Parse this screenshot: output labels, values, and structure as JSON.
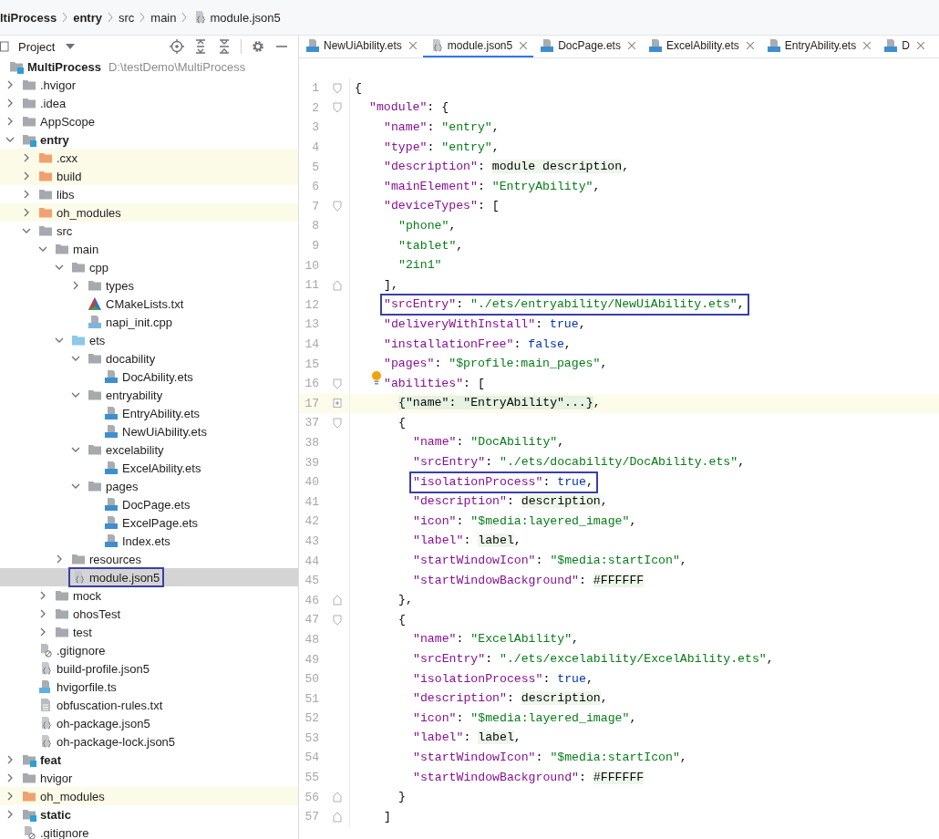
{
  "breadcrumb": [
    {
      "label": "ltiProcess",
      "kind": "module"
    },
    {
      "label": "entry",
      "kind": "module"
    },
    {
      "label": "src",
      "kind": "folder"
    },
    {
      "label": "main",
      "kind": "folder"
    },
    {
      "label": "module.json5",
      "kind": "json"
    }
  ],
  "project_panel": {
    "title": "Project",
    "root": {
      "label": "MultiProcess",
      "path": "D:\\testDemo\\MultiProcess"
    },
    "tree": [
      {
        "label": ".hvigor",
        "kind": "folder",
        "expanded": false,
        "selected": false
      },
      {
        "label": ".idea",
        "kind": "folder",
        "expanded": false,
        "selected": false
      },
      {
        "label": "AppScope",
        "kind": "folder",
        "expanded": false,
        "selected": false
      },
      {
        "label": "entry",
        "kind": "module",
        "expanded": true,
        "selected": false,
        "children": [
          {
            "label": ".cxx",
            "kind": "excluded",
            "expanded": false,
            "selected": false
          },
          {
            "label": "build",
            "kind": "excluded",
            "expanded": false,
            "selected": false
          },
          {
            "label": "libs",
            "kind": "folder",
            "expanded": false,
            "selected": false
          },
          {
            "label": "oh_modules",
            "kind": "excluded",
            "expanded": false,
            "selected": false
          },
          {
            "label": "src",
            "kind": "folder",
            "expanded": true,
            "selected": false,
            "children": [
              {
                "label": "main",
                "kind": "folder",
                "expanded": true,
                "selected": false,
                "children": [
                  {
                    "label": "cpp",
                    "kind": "folder",
                    "expanded": true,
                    "selected": false,
                    "children": [
                      {
                        "label": "types",
                        "kind": "folder",
                        "expanded": false,
                        "selected": false
                      },
                      {
                        "label": "CMakeLists.txt",
                        "kind": "cmake",
                        "selected": false
                      },
                      {
                        "label": "napi_init.cpp",
                        "kind": "cpp",
                        "selected": false
                      }
                    ]
                  },
                  {
                    "label": "ets",
                    "kind": "source",
                    "expanded": true,
                    "selected": false,
                    "children": [
                      {
                        "label": "docability",
                        "kind": "folder",
                        "expanded": true,
                        "selected": false,
                        "children": [
                          {
                            "label": "DocAbility.ets",
                            "kind": "ets",
                            "selected": false
                          }
                        ]
                      },
                      {
                        "label": "entryability",
                        "kind": "folder",
                        "expanded": true,
                        "selected": false,
                        "children": [
                          {
                            "label": "EntryAbility.ets",
                            "kind": "ets",
                            "selected": false
                          },
                          {
                            "label": "NewUiAbility.ets",
                            "kind": "ets",
                            "selected": false
                          }
                        ]
                      },
                      {
                        "label": "excelability",
                        "kind": "folder",
                        "expanded": true,
                        "selected": false,
                        "children": [
                          {
                            "label": "ExcelAbility.ets",
                            "kind": "ets",
                            "selected": false
                          }
                        ]
                      },
                      {
                        "label": "pages",
                        "kind": "folder",
                        "expanded": true,
                        "selected": false,
                        "children": [
                          {
                            "label": "DocPage.ets",
                            "kind": "ets",
                            "selected": false
                          },
                          {
                            "label": "ExcelPage.ets",
                            "kind": "ets",
                            "selected": false
                          },
                          {
                            "label": "Index.ets",
                            "kind": "ets",
                            "selected": false
                          }
                        ]
                      }
                    ]
                  },
                  {
                    "label": "resources",
                    "kind": "folder",
                    "expanded": false,
                    "selected": false
                  },
                  {
                    "label": "module.json5",
                    "kind": "json",
                    "selected": true,
                    "boxed": true
                  }
                ]
              },
              {
                "label": "mock",
                "kind": "folder",
                "expanded": false,
                "selected": false
              },
              {
                "label": "ohosTest",
                "kind": "folder",
                "expanded": false,
                "selected": false
              },
              {
                "label": "test",
                "kind": "folder",
                "expanded": false,
                "selected": false
              }
            ]
          },
          {
            "label": ".gitignore",
            "kind": "ignore",
            "selected": false
          },
          {
            "label": "build-profile.json5",
            "kind": "json",
            "selected": false
          },
          {
            "label": "hvigorfile.ts",
            "kind": "ts",
            "selected": false
          },
          {
            "label": "obfuscation-rules.txt",
            "kind": "txt",
            "selected": false
          },
          {
            "label": "oh-package.json5",
            "kind": "json",
            "selected": false
          },
          {
            "label": "oh-package-lock.json5",
            "kind": "json",
            "selected": false
          }
        ]
      },
      {
        "label": "feat",
        "kind": "module",
        "expanded": false,
        "selected": false
      },
      {
        "label": "hvigor",
        "kind": "folder",
        "expanded": false,
        "selected": false
      },
      {
        "label": "oh_modules",
        "kind": "excluded",
        "expanded": false,
        "selected": false
      },
      {
        "label": "static",
        "kind": "module",
        "expanded": false,
        "selected": false
      },
      {
        "label": ".gitignore",
        "kind": "ignore",
        "selected": false
      }
    ]
  },
  "tabs": [
    {
      "label": "NewUiAbility.ets",
      "kind": "ets",
      "selected": false
    },
    {
      "label": "module.json5",
      "kind": "json",
      "selected": true
    },
    {
      "label": "DocPage.ets",
      "kind": "ets",
      "selected": false
    },
    {
      "label": "ExcelAbility.ets",
      "kind": "ets",
      "selected": false
    },
    {
      "label": "EntryAbility.ets",
      "kind": "ets",
      "selected": false
    },
    {
      "label": "D",
      "kind": "ets",
      "selected": false
    }
  ],
  "editor": {
    "lines": [
      {
        "no": "1",
        "tokens": [
          {
            "kind": "punct",
            "text": "{"
          }
        ],
        "children": [
          {
            "no": "2",
            "tokens": [
              {
                "kind": "key",
                "text": "\"module\""
              },
              {
                "kind": "punct",
                "text": ": {"
              }
            ],
            "children": [
              {
                "no": "3",
                "tokens": [
                  {
                    "kind": "key",
                    "text": "\"name\""
                  },
                  {
                    "kind": "punct",
                    "text": ": "
                  },
                  {
                    "kind": "str",
                    "text": "\"entry\""
                  },
                  {
                    "kind": "punct",
                    "text": ","
                  }
                ]
              },
              {
                "no": "4",
                "tokens": [
                  {
                    "kind": "key",
                    "text": "\"type\""
                  },
                  {
                    "kind": "punct",
                    "text": ": "
                  },
                  {
                    "kind": "str",
                    "text": "\"entry\""
                  },
                  {
                    "kind": "punct",
                    "text": ","
                  }
                ]
              },
              {
                "no": "5",
                "tokens": [
                  {
                    "kind": "key",
                    "text": "\"description\""
                  },
                  {
                    "kind": "punct",
                    "text": ": "
                  },
                  {
                    "kind": "res",
                    "text": "module description"
                  },
                  {
                    "kind": "punct",
                    "text": ","
                  }
                ]
              },
              {
                "no": "6",
                "tokens": [
                  {
                    "kind": "key",
                    "text": "\"mainElement\""
                  },
                  {
                    "kind": "punct",
                    "text": ": "
                  },
                  {
                    "kind": "str",
                    "text": "\"EntryAbility\""
                  },
                  {
                    "kind": "punct",
                    "text": ","
                  }
                ]
              },
              {
                "no": "7",
                "tokens": [
                  {
                    "kind": "key",
                    "text": "\"deviceTypes\""
                  },
                  {
                    "kind": "punct",
                    "text": ": ["
                  }
                ],
                "children": [
                  {
                    "no": "8",
                    "tokens": [
                      {
                        "kind": "str",
                        "text": "\"phone\""
                      },
                      {
                        "kind": "punct",
                        "text": ","
                      }
                    ]
                  },
                  {
                    "no": "9",
                    "tokens": [
                      {
                        "kind": "str",
                        "text": "\"tablet\""
                      },
                      {
                        "kind": "punct",
                        "text": ","
                      }
                    ]
                  },
                  {
                    "no": "10",
                    "tokens": [
                      {
                        "kind": "str",
                        "text": "\"2in1\""
                      }
                    ]
                  }
                ]
              },
              {
                "no": "11",
                "fold_end": true,
                "tokens": [
                  {
                    "kind": "punct",
                    "text": "],"
                  }
                ]
              },
              {
                "no": "12",
                "boxed": true,
                "tokens": [
                  {
                    "kind": "key",
                    "text": "\"srcEntry\""
                  },
                  {
                    "kind": "punct",
                    "text": ": "
                  },
                  {
                    "kind": "str",
                    "text": "\"./ets/entryability/NewUiAbility.ets\""
                  },
                  {
                    "kind": "punct",
                    "text": ","
                  }
                ]
              },
              {
                "no": "13",
                "tokens": [
                  {
                    "kind": "key",
                    "text": "\"deliveryWithInstall\""
                  },
                  {
                    "kind": "punct",
                    "text": ": "
                  },
                  {
                    "kind": "kw",
                    "text": "true"
                  },
                  {
                    "kind": "punct",
                    "text": ","
                  }
                ]
              },
              {
                "no": "14",
                "tokens": [
                  {
                    "kind": "key",
                    "text": "\"installationFree\""
                  },
                  {
                    "kind": "punct",
                    "text": ": "
                  },
                  {
                    "kind": "kw",
                    "text": "false"
                  },
                  {
                    "kind": "punct",
                    "text": ","
                  }
                ]
              },
              {
                "no": "15",
                "tokens": [
                  {
                    "kind": "key",
                    "text": "\"pages\""
                  },
                  {
                    "kind": "punct",
                    "text": ": "
                  },
                  {
                    "kind": "str",
                    "text": "\"$profile:main_pages\""
                  },
                  {
                    "kind": "punct",
                    "text": ","
                  }
                ]
              },
              {
                "no": "16",
                "bulb": true,
                "tokens": [
                  {
                    "kind": "key",
                    "text": "\"abilities\""
                  },
                  {
                    "kind": "punct",
                    "text": ": ["
                  }
                ],
                "children": [
                  {
                    "no": "17",
                    "collapsed": true,
                    "current": true,
                    "tokens": [
                      {
                        "kind": "folded",
                        "text": "{\"name\": \"EntryAbility\"...}"
                      },
                      {
                        "kind": "punct",
                        "text": ","
                      }
                    ]
                  },
                  {
                    "no": "37",
                    "tokens": [
                      {
                        "kind": "punct",
                        "text": "{"
                      }
                    ],
                    "children": [
                      {
                        "no": "38",
                        "tokens": [
                          {
                            "kind": "key",
                            "text": "\"name\""
                          },
                          {
                            "kind": "punct",
                            "text": ": "
                          },
                          {
                            "kind": "str",
                            "text": "\"DocAbility\""
                          },
                          {
                            "kind": "punct",
                            "text": ","
                          }
                        ]
                      },
                      {
                        "no": "39",
                        "tokens": [
                          {
                            "kind": "key",
                            "text": "\"srcEntry\""
                          },
                          {
                            "kind": "punct",
                            "text": ": "
                          },
                          {
                            "kind": "str",
                            "text": "\"./ets/docability/DocAbility.ets\""
                          },
                          {
                            "kind": "punct",
                            "text": ","
                          }
                        ]
                      },
                      {
                        "no": "40",
                        "boxed": true,
                        "tokens": [
                          {
                            "kind": "key",
                            "text": "\"isolationProcess\""
                          },
                          {
                            "kind": "punct",
                            "text": ": "
                          },
                          {
                            "kind": "kw",
                            "text": "true"
                          },
                          {
                            "kind": "punct",
                            "text": ","
                          }
                        ]
                      },
                      {
                        "no": "41",
                        "tokens": [
                          {
                            "kind": "key",
                            "text": "\"description\""
                          },
                          {
                            "kind": "punct",
                            "text": ": "
                          },
                          {
                            "kind": "res",
                            "text": "description"
                          },
                          {
                            "kind": "punct",
                            "text": ","
                          }
                        ]
                      },
                      {
                        "no": "42",
                        "tokens": [
                          {
                            "kind": "key",
                            "text": "\"icon\""
                          },
                          {
                            "kind": "punct",
                            "text": ": "
                          },
                          {
                            "kind": "str",
                            "text": "\"$media:layered_image\""
                          },
                          {
                            "kind": "punct",
                            "text": ","
                          }
                        ]
                      },
                      {
                        "no": "43",
                        "tokens": [
                          {
                            "kind": "key",
                            "text": "\"label\""
                          },
                          {
                            "kind": "punct",
                            "text": ": "
                          },
                          {
                            "kind": "res",
                            "text": "label"
                          },
                          {
                            "kind": "punct",
                            "text": ","
                          }
                        ]
                      },
                      {
                        "no": "44",
                        "tokens": [
                          {
                            "kind": "key",
                            "text": "\"startWindowIcon\""
                          },
                          {
                            "kind": "punct",
                            "text": ": "
                          },
                          {
                            "kind": "str",
                            "text": "\"$media:startIcon\""
                          },
                          {
                            "kind": "punct",
                            "text": ","
                          }
                        ]
                      },
                      {
                        "no": "45",
                        "tokens": [
                          {
                            "kind": "key",
                            "text": "\"startWindowBackground\""
                          },
                          {
                            "kind": "punct",
                            "text": ": "
                          },
                          {
                            "kind": "res",
                            "text": "#FFFFFF"
                          }
                        ]
                      }
                    ]
                  },
                  {
                    "no": "46",
                    "fold_end": true,
                    "tokens": [
                      {
                        "kind": "punct",
                        "text": "},"
                      }
                    ]
                  },
                  {
                    "no": "47",
                    "tokens": [
                      {
                        "kind": "punct",
                        "text": "{"
                      }
                    ],
                    "children": [
                      {
                        "no": "48",
                        "tokens": [
                          {
                            "kind": "key",
                            "text": "\"name\""
                          },
                          {
                            "kind": "punct",
                            "text": ": "
                          },
                          {
                            "kind": "str",
                            "text": "\"ExcelAbility\""
                          },
                          {
                            "kind": "punct",
                            "text": ","
                          }
                        ]
                      },
                      {
                        "no": "49",
                        "tokens": [
                          {
                            "kind": "key",
                            "text": "\"srcEntry\""
                          },
                          {
                            "kind": "punct",
                            "text": ": "
                          },
                          {
                            "kind": "str",
                            "text": "\"./ets/excelability/ExcelAbility.ets\""
                          },
                          {
                            "kind": "punct",
                            "text": ","
                          }
                        ]
                      },
                      {
                        "no": "50",
                        "tokens": [
                          {
                            "kind": "key",
                            "text": "\"isolationProcess\""
                          },
                          {
                            "kind": "punct",
                            "text": ": "
                          },
                          {
                            "kind": "kw",
                            "text": "true"
                          },
                          {
                            "kind": "punct",
                            "text": ","
                          }
                        ]
                      },
                      {
                        "no": "51",
                        "tokens": [
                          {
                            "kind": "key",
                            "text": "\"description\""
                          },
                          {
                            "kind": "punct",
                            "text": ": "
                          },
                          {
                            "kind": "res",
                            "text": "description"
                          },
                          {
                            "kind": "punct",
                            "text": ","
                          }
                        ]
                      },
                      {
                        "no": "52",
                        "tokens": [
                          {
                            "kind": "key",
                            "text": "\"icon\""
                          },
                          {
                            "kind": "punct",
                            "text": ": "
                          },
                          {
                            "kind": "str",
                            "text": "\"$media:layered_image\""
                          },
                          {
                            "kind": "punct",
                            "text": ","
                          }
                        ]
                      },
                      {
                        "no": "53",
                        "tokens": [
                          {
                            "kind": "key",
                            "text": "\"label\""
                          },
                          {
                            "kind": "punct",
                            "text": ": "
                          },
                          {
                            "kind": "res",
                            "text": "label"
                          },
                          {
                            "kind": "punct",
                            "text": ","
                          }
                        ]
                      },
                      {
                        "no": "54",
                        "tokens": [
                          {
                            "kind": "key",
                            "text": "\"startWindowIcon\""
                          },
                          {
                            "kind": "punct",
                            "text": ": "
                          },
                          {
                            "kind": "str",
                            "text": "\"$media:startIcon\""
                          },
                          {
                            "kind": "punct",
                            "text": ","
                          }
                        ]
                      },
                      {
                        "no": "55",
                        "tokens": [
                          {
                            "kind": "key",
                            "text": "\"startWindowBackground\""
                          },
                          {
                            "kind": "punct",
                            "text": ": "
                          },
                          {
                            "kind": "res",
                            "text": "#FFFFFF"
                          }
                        ]
                      }
                    ]
                  },
                  {
                    "no": "56",
                    "fold_end": true,
                    "tokens": [
                      {
                        "kind": "punct",
                        "text": "}"
                      }
                    ]
                  }
                ]
              },
              {
                "no": "57",
                "fold_end": true,
                "tokens": [
                  {
                    "kind": "punct",
                    "text": "]"
                  }
                ]
              }
            ]
          }
        ]
      }
    ]
  }
}
